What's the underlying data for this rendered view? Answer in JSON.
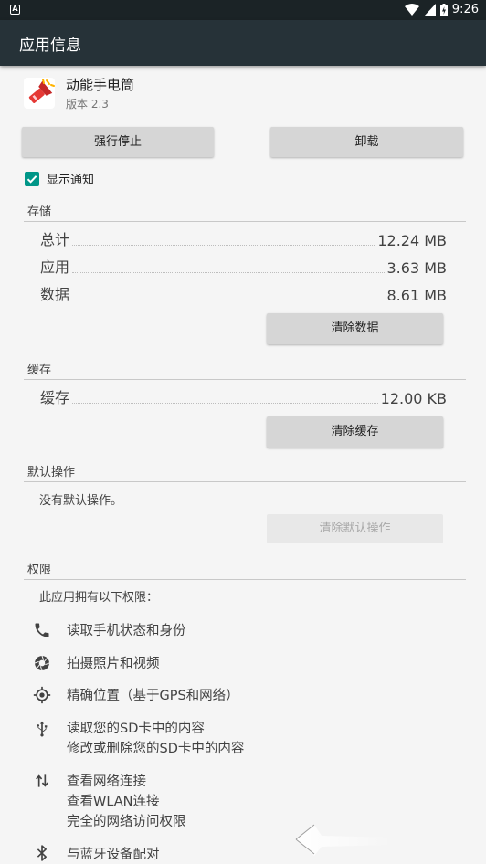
{
  "status_bar": {
    "time": "9:26"
  },
  "app_bar": {
    "title": "应用信息"
  },
  "app": {
    "name": "动能手电筒",
    "version": "版本 2.3"
  },
  "actions": {
    "force_stop": "强行停止",
    "uninstall": "卸载"
  },
  "notifications": {
    "label": "显示通知",
    "checked": true
  },
  "storage": {
    "title": "存储",
    "rows": [
      {
        "label": "总计",
        "value": "12.24 MB"
      },
      {
        "label": "应用",
        "value": "3.63 MB"
      },
      {
        "label": "数据",
        "value": "8.61 MB"
      }
    ],
    "clear_button": "清除数据"
  },
  "cache": {
    "title": "缓存",
    "row": {
      "label": "缓存",
      "value": "12.00 KB"
    },
    "clear_button": "清除缓存"
  },
  "defaults": {
    "title": "默认操作",
    "text": "没有默认操作。",
    "clear_button": "清除默认操作"
  },
  "permissions": {
    "title": "权限",
    "intro": "此应用拥有以下权限：",
    "items": [
      {
        "icon": "phone-icon",
        "lines": [
          "读取手机状态和身份"
        ]
      },
      {
        "icon": "camera-icon",
        "lines": [
          "拍摄照片和视频"
        ]
      },
      {
        "icon": "location-icon",
        "lines": [
          "精确位置（基于GPS和网络）"
        ]
      },
      {
        "icon": "usb-icon",
        "lines": [
          "读取您的SD卡中的内容",
          "修改或删除您的SD卡中的内容"
        ]
      },
      {
        "icon": "network-icon",
        "lines": [
          "查看网络连接",
          "查看WLAN连接",
          "完全的网络访问权限"
        ]
      },
      {
        "icon": "bluetooth-icon",
        "lines": [
          "与蓝牙设备配对"
        ]
      }
    ]
  },
  "colors": {
    "accent": "#009688",
    "app_bar": "#263238",
    "status_bar": "#1b2326"
  }
}
